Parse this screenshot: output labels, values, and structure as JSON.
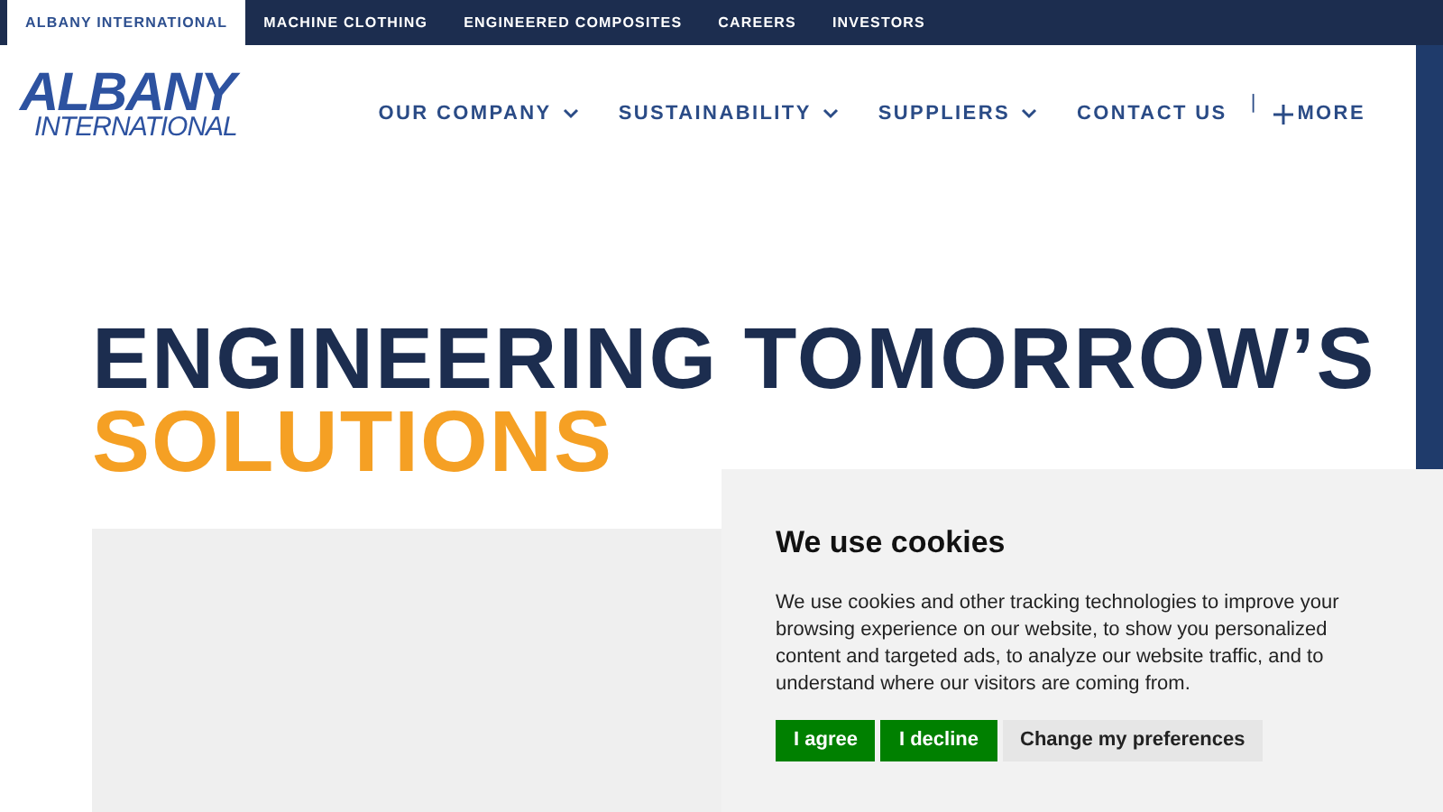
{
  "top_bar": {
    "tabs": [
      {
        "label": "ALBANY INTERNATIONAL",
        "selected": true
      },
      {
        "label": "MACHINE CLOTHING",
        "selected": false
      },
      {
        "label": "ENGINEERED COMPOSITES",
        "selected": false
      },
      {
        "label": "CAREERS",
        "selected": false
      },
      {
        "label": "INVESTORS",
        "selected": false
      }
    ]
  },
  "logo": {
    "line_1": "ALBANY",
    "line_2": "INTERNATIONAL"
  },
  "main_nav": [
    {
      "label": "OUR COMPANY",
      "kind": "dropdown"
    },
    {
      "label": "SUSTAINABILITY",
      "kind": "dropdown"
    },
    {
      "label": "SUPPLIERS",
      "kind": "dropdown"
    },
    {
      "label": "CONTACT US",
      "kind": "link"
    },
    {
      "label": "|",
      "kind": "separator"
    },
    {
      "label": "MORE",
      "kind": "more"
    }
  ],
  "hero": {
    "title_line_1": "ENGINEERING TOMORROW’S",
    "title_line_2": "SOLUTIONS"
  },
  "cookie_banner": {
    "title": "We use cookies",
    "text": "We use cookies and other tracking technologies to improve your browsing experience on our website, to show you personalized content and targeted ads, to analyze our website traffic, and to understand where our visitors are coming from.",
    "buttons": [
      {
        "label": "I agree",
        "kind": "primary"
      },
      {
        "label": "I decline",
        "kind": "primary"
      },
      {
        "label": "Change my preferences",
        "kind": "secondary"
      }
    ]
  }
}
